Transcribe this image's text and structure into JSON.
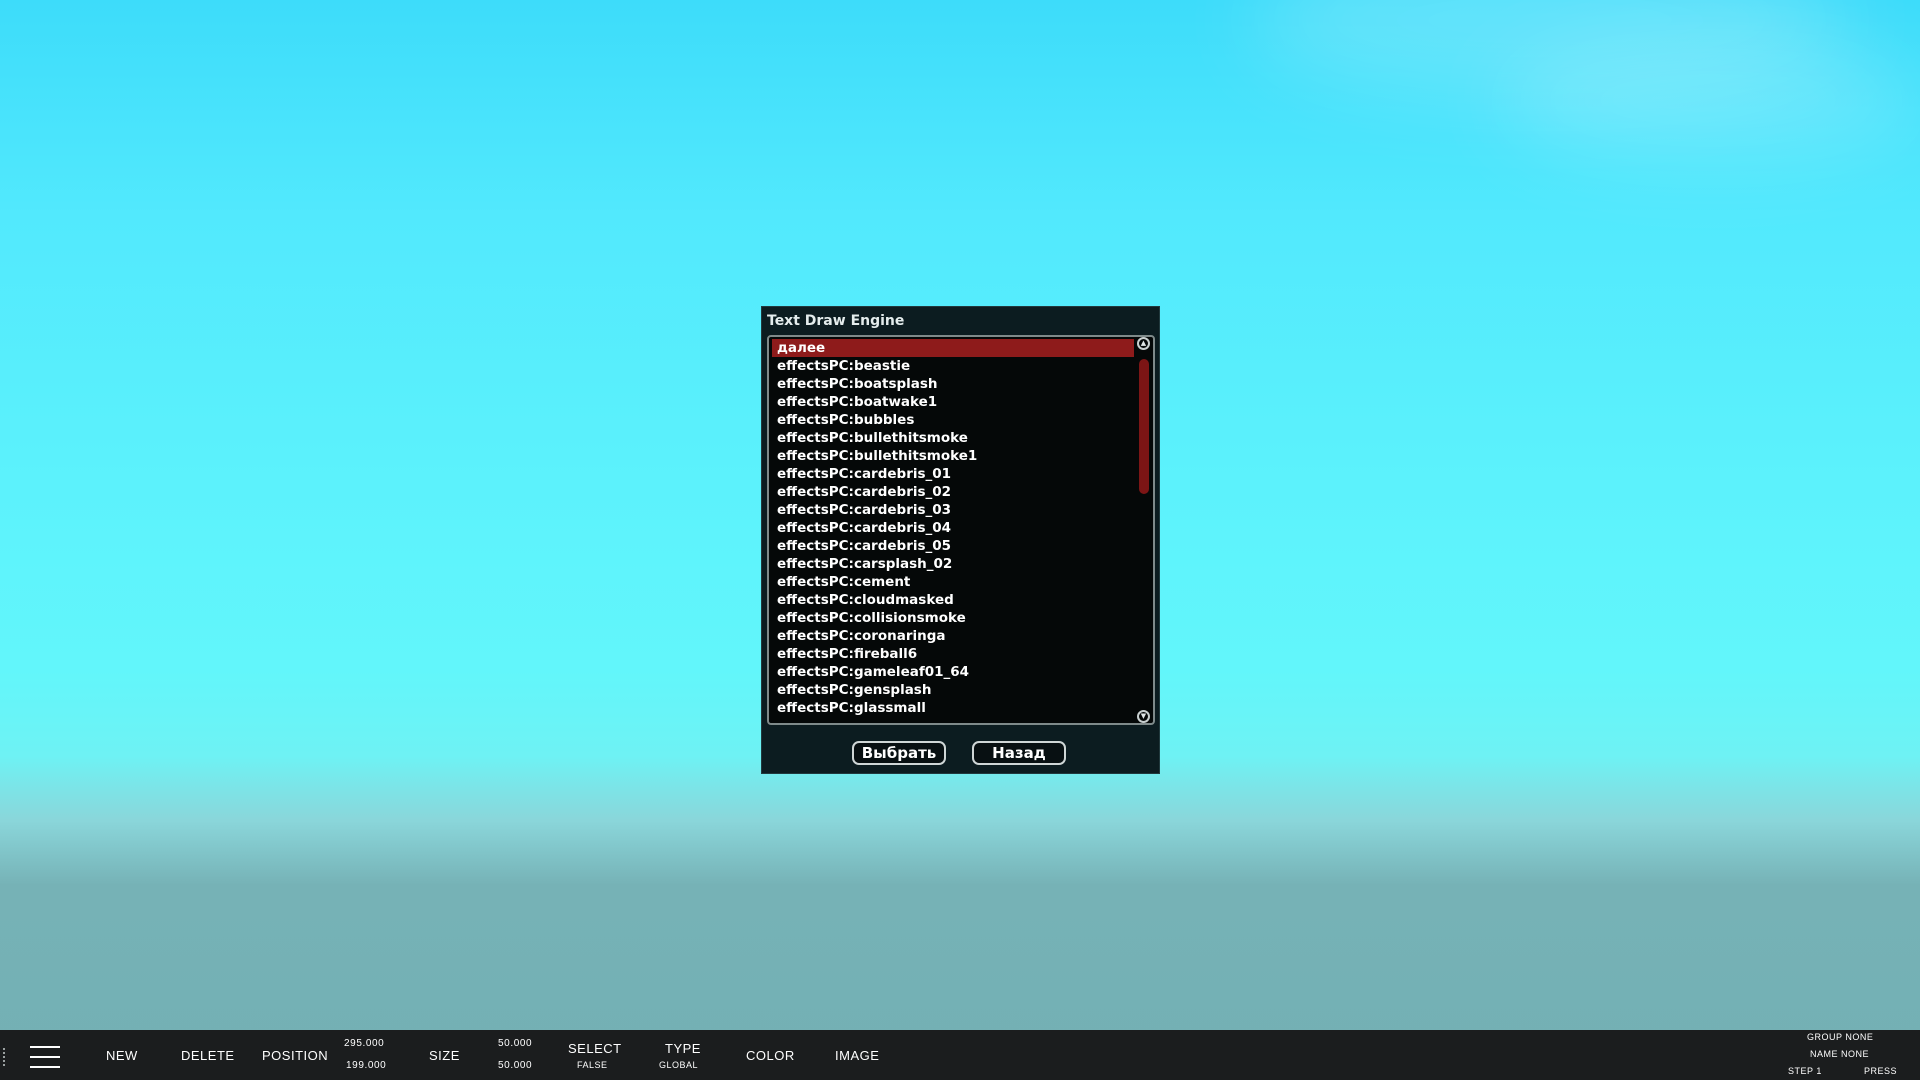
{
  "dialog": {
    "title": "Text Draw Engine",
    "items": [
      "далее",
      "effectsPC:beastie",
      "effectsPC:boatsplash",
      "effectsPC:boatwake1",
      "effectsPC:bubbles",
      "effectsPC:bullethitsmoke",
      "effectsPC:bullethitsmoke1",
      "effectsPC:cardebris_01",
      "effectsPC:cardebris_02",
      "effectsPC:cardebris_03",
      "effectsPC:cardebris_04",
      "effectsPC:cardebris_05",
      "effectsPC:carsplash_02",
      "effectsPC:cement",
      "effectsPC:cloudmasked",
      "effectsPC:collisionsmoke",
      "effectsPC:coronaringa",
      "effectsPC:fireball6",
      "effectsPC:gameleaf01_64",
      "effectsPC:gensplash",
      "effectsPC:glassmall"
    ],
    "selected_index": 0,
    "select_button": "Выбрать",
    "back_button": "Назад",
    "colors": {
      "selection": "#8e1b1b",
      "scroll_thumb": "#7c1515"
    }
  },
  "toolbar": {
    "new": "NEW",
    "delete": "DELETE",
    "position": "POSITION",
    "position_x": "295.000",
    "position_y": "199.000",
    "size": "SIZE",
    "size_x": "50.000",
    "size_y": "50.000",
    "select": "SELECT",
    "select_value": "FALSE",
    "type": "TYPE",
    "type_value": "GLOBAL",
    "color": "COLOR",
    "image": "IMAGE",
    "group": "GROUP NONE",
    "name": "NAME NONE",
    "step": "STEP 1",
    "press": "PRESS",
    "menu_icon": "hamburger-menu-icon"
  }
}
